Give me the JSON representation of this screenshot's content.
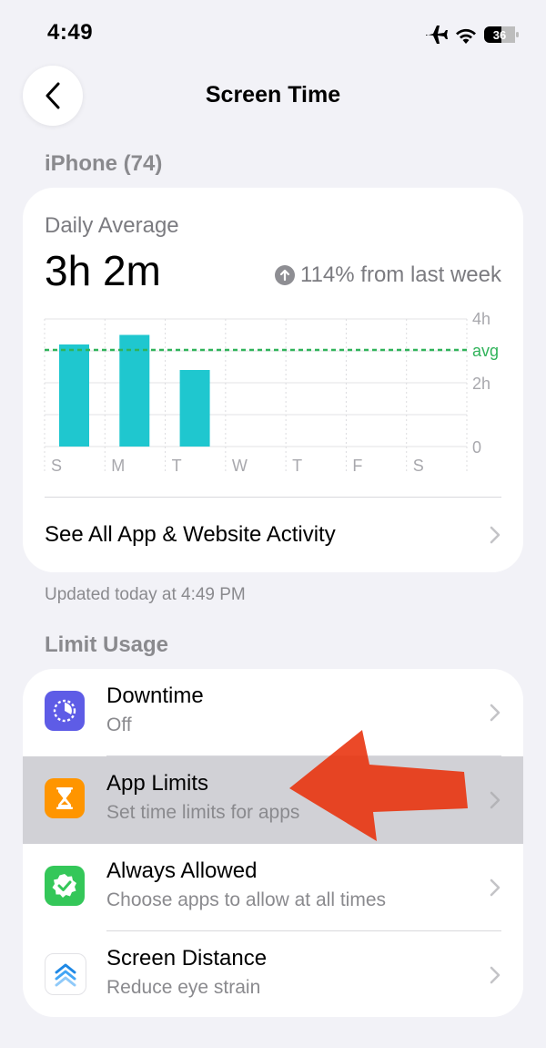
{
  "status_bar": {
    "time": "4:49",
    "battery": "36"
  },
  "nav": {
    "title": "Screen Time"
  },
  "device_section": {
    "header": "iPhone (74)"
  },
  "usage_card": {
    "daily_average_label": "Daily Average",
    "daily_average_value": "3h 2m",
    "change_text": "114% from last week",
    "see_all_label": "See All App & Website Activity"
  },
  "chart_data": {
    "type": "bar",
    "categories": [
      "S",
      "M",
      "T",
      "W",
      "T",
      "F",
      "S"
    ],
    "values": [
      3.2,
      3.5,
      2.4,
      null,
      null,
      null,
      null
    ],
    "y_ticks": [
      {
        "label": "4h",
        "value": 4
      },
      {
        "label": "2h",
        "value": 2
      },
      {
        "label": "0",
        "value": 0
      }
    ],
    "ylim": [
      0,
      4
    ],
    "average_line": {
      "label": "avg",
      "value": 3.03,
      "color": "#30b35a"
    },
    "bar_color": "#1fc7cf",
    "grid": true
  },
  "updated_text": "Updated today at 4:49 PM",
  "limit_section": {
    "header": "Limit Usage",
    "items": [
      {
        "title": "Downtime",
        "subtitle": "Off",
        "icon": "downtime-icon",
        "color": "#5e5ce6",
        "selected": false
      },
      {
        "title": "App Limits",
        "subtitle": "Set time limits for apps",
        "icon": "hourglass-icon",
        "color": "#ff9500",
        "selected": true
      },
      {
        "title": "Always Allowed",
        "subtitle": "Choose apps to allow at all times",
        "icon": "checkmark-badge-icon",
        "color": "#34c759",
        "selected": false
      },
      {
        "title": "Screen Distance",
        "subtitle": "Reduce eye strain",
        "icon": "screen-distance-icon",
        "color": "#ffffff",
        "selected": false
      }
    ]
  },
  "colors": {
    "background": "#f2f2f7",
    "annotation_arrow": "#e8300a"
  }
}
